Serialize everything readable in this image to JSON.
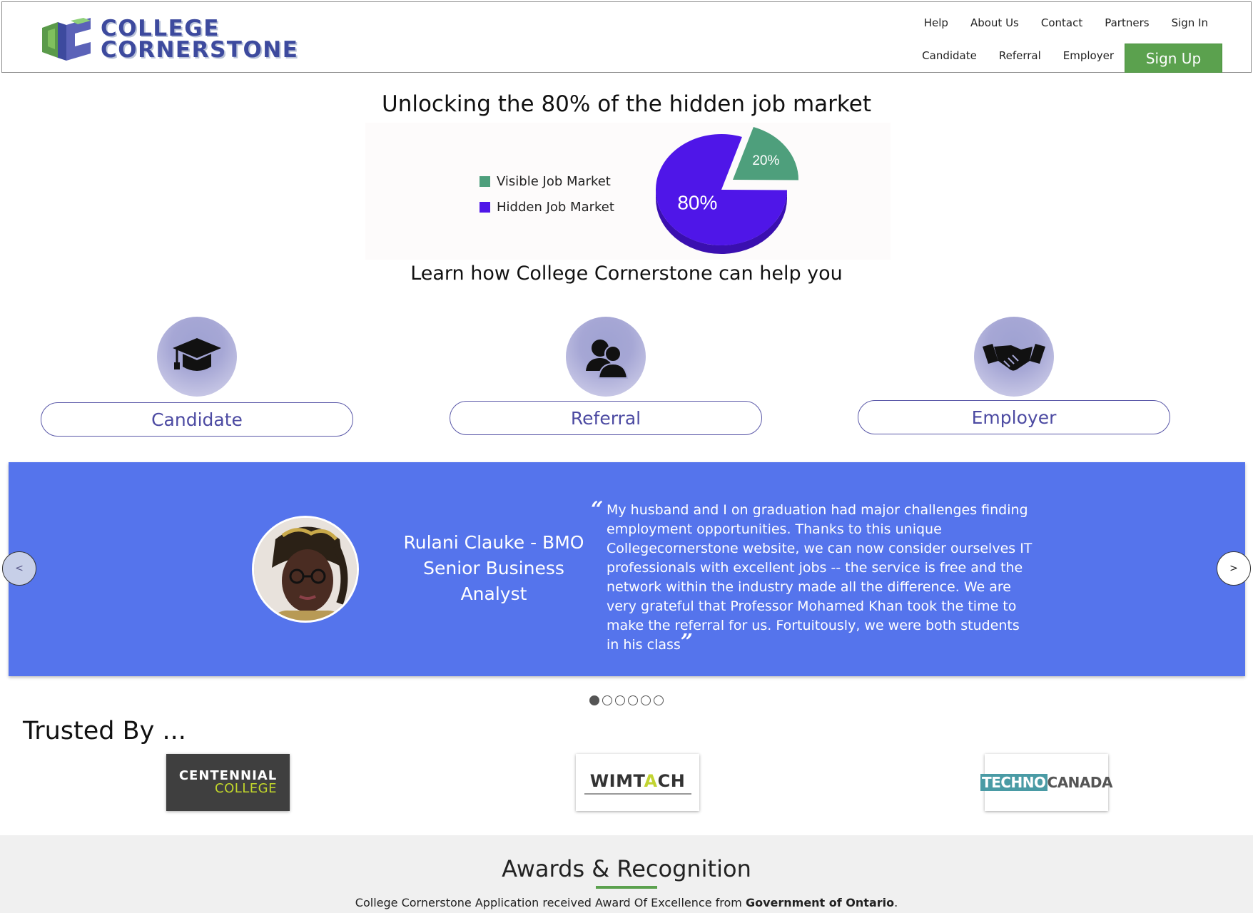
{
  "header": {
    "logo_line1": "COLLEGE",
    "logo_line2": "CORNERSTONE",
    "nav_top": [
      "Help",
      "About Us",
      "Contact",
      "Partners",
      "Sign In"
    ],
    "nav_bottom": [
      "Candidate",
      "Referral",
      "Employer"
    ],
    "signup_label": "Sign Up"
  },
  "hero": {
    "title": "Unlocking the 80% of the hidden job market",
    "subtitle": "Learn how College Cornerstone can help you"
  },
  "chart_data": {
    "type": "pie",
    "categories": [
      "Visible Job Market",
      "Hidden Job Market"
    ],
    "values": [
      20,
      80
    ],
    "labels": [
      "20%",
      "80%"
    ],
    "colors": [
      "#4e9f7c",
      "#4f16e8"
    ],
    "legend": "left"
  },
  "roles": [
    {
      "label": "Candidate",
      "icon": "graduation-cap-icon"
    },
    {
      "label": "Referral",
      "icon": "people-icon"
    },
    {
      "label": "Employer",
      "icon": "handshake-icon"
    }
  ],
  "testimonial": {
    "person_line1": "Rulani Clauke - BMO",
    "person_line2": "Senior Business",
    "person_line3": "Analyst",
    "quote": "My husband and I on graduation had major challenges finding employment opportunities. Thanks to this unique Collegecornerstone website, we can now consider ourselves IT professionals with excellent jobs -- the service is free and the network within the industry made all the difference. We are very grateful that Professor Mohamed Khan took the time to make the referral for us. Fortuitously, we were both students in his class",
    "open_quote": "“",
    "close_quote": "”",
    "prev_label": "<",
    "next_label": ">",
    "slide_count": 6,
    "active_slide": 1
  },
  "trusted": {
    "title": "Trusted By ...",
    "partners": {
      "centennial_1": "CENTENNIAL",
      "centennial_2": "COLLEGE",
      "wimtach_pre": "WIMT",
      "wimtach_a": "A",
      "wimtach_post": "CH",
      "techno_1": "TECHNO",
      "techno_2": "CANADA"
    }
  },
  "awards": {
    "title": "Awards & Recognition",
    "text_before": "College Cornerstone Application received Award Of Excellence from ",
    "text_bold": "Government of Ontario",
    "text_after": "."
  },
  "colors": {
    "brand": "#3d4a9e",
    "signup": "#5ba14e",
    "testimonial_bg": "#5574ec",
    "role_text": "#4c4aa2"
  }
}
